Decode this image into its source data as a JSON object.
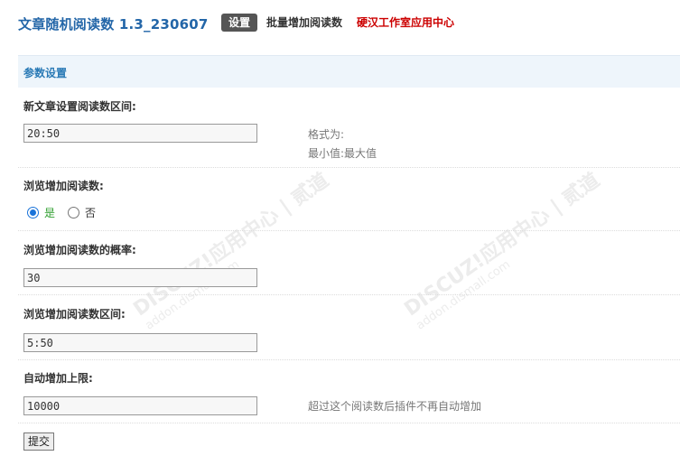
{
  "header": {
    "title": "文章随机阅读数 1.3_230607",
    "tabs": [
      {
        "label": "设置",
        "active": true
      },
      {
        "label": "批量增加阅读数",
        "active": false
      },
      {
        "label": "硬汉工作室应用中心",
        "active": false
      }
    ]
  },
  "section": {
    "title": "参数设置"
  },
  "fields": {
    "interval_label": "新文章设置阅读数区间:",
    "interval_value": "20:50",
    "interval_hint_1": "格式为:",
    "interval_hint_2": "最小值:最大值",
    "increase_label": "浏览增加阅读数:",
    "increase_yes": "是",
    "increase_no": "否",
    "probability_label": "浏览增加阅读数的概率:",
    "probability_value": "30",
    "range_label": "浏览增加阅读数区间:",
    "range_value": "5:50",
    "limit_label": "自动增加上限:",
    "limit_value": "10000",
    "limit_hint": "超过这个阅读数后插件不再自动增加"
  },
  "submit_label": "提交",
  "watermark": {
    "line1": "DISCUZ!应用中心 | 贰道",
    "line2": "addon.dismall.com"
  },
  "colors": {
    "title": "#2366a8",
    "section_bg": "#eef5fb",
    "section_title": "#2a7ab6",
    "red_link": "#cc0000"
  }
}
